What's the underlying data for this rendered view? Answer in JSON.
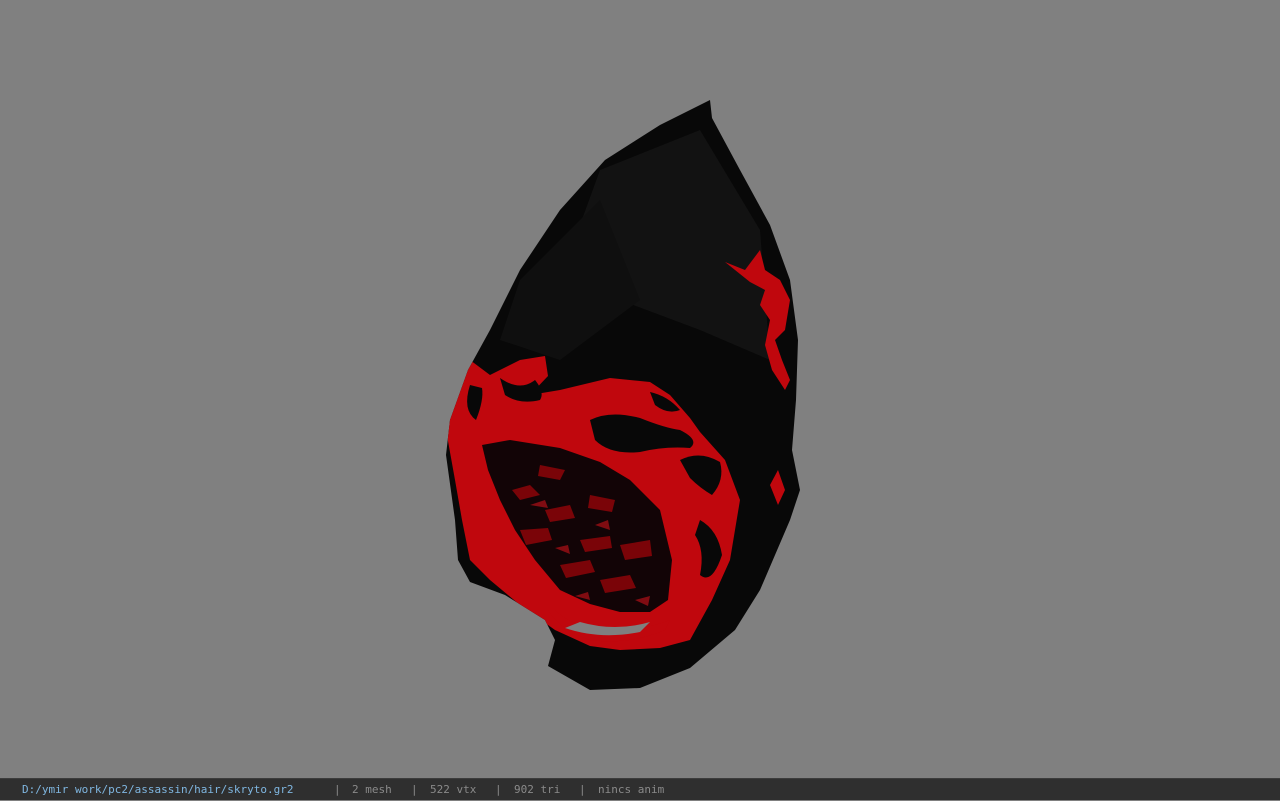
{
  "viewer": {
    "background_color": "#808080",
    "model_colors": {
      "cloth": "#0a0a0a",
      "flame": "#c0070d",
      "flame_dark": "#7a0408"
    }
  },
  "status": {
    "file_path": "D:/ymir work/pc2/assassin/hair/skryto.gr2",
    "separator": "|",
    "mesh_count": "2 mesh",
    "vertex_count": "522 vtx",
    "triangle_count": "902 tri",
    "anim_status": "nincs anim"
  }
}
